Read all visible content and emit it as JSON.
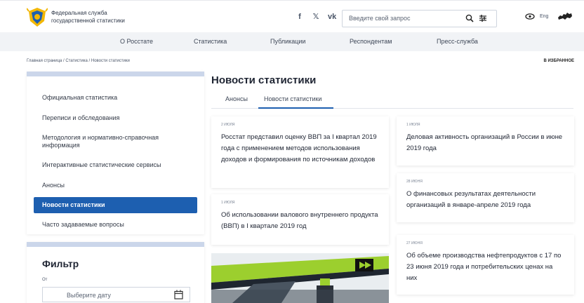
{
  "header": {
    "brand_line1": "Федеральная служба",
    "brand_line2": "государственной статистики",
    "social": [
      "f",
      "𝕏",
      "vk"
    ],
    "search_placeholder": "Введите свой запрос",
    "lang": "Eng"
  },
  "nav": {
    "items": [
      "О Росстате",
      "Статистика",
      "Публикации",
      "Респондентам",
      "Пресс-служба"
    ]
  },
  "breadcrumb": "Главная страница / Статистика / Новости статистики",
  "favorites": "В ИЗБРАННОЕ",
  "sidebar": {
    "items": [
      "Официальная статистика",
      "Переписи и обследования",
      "Методология и нормативно-справочная информация",
      "Интерактивные статистические сервисы",
      "Анонсы",
      "Новости статистики",
      "Часто задаваемые вопросы"
    ],
    "active_index": 5
  },
  "filter": {
    "title": "Фильтр",
    "from_label": "От",
    "date_placeholder": "Выберите дату"
  },
  "main": {
    "title": "Новости статистики",
    "tabs": [
      "Анонсы",
      "Новости статистики"
    ],
    "active_tab": 1
  },
  "news": [
    {
      "date": "2 июля",
      "title": "Росстат представил оценку ВВП за I квартал 2019 года с применением методов использования доходов и формирования по источникам доходов"
    },
    {
      "date": "1 июля",
      "title": "Об использовании валового внутреннего продукта (ВВП) в I квартале 2019 год"
    },
    {
      "date": "1 июля",
      "title": "Деловая активность организаций в России в июне 2019 года"
    },
    {
      "date": "28 июня",
      "title": "О финансовых результатах деятельности организаций в январе-апреле 2019 года"
    },
    {
      "date": "27 июня",
      "title": "Об объеме производства нефтепродуктов с 17 по 23 июня 2019 года и потребительских ценах на них"
    }
  ],
  "colors": {
    "accent": "#1d5fb0",
    "card_top": "#cbd6ea",
    "nav_bg": "#f1f3f6"
  }
}
